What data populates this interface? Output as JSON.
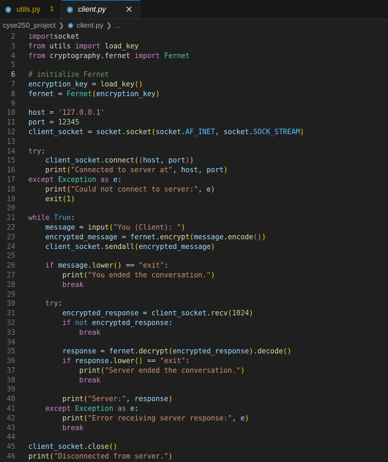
{
  "tabs": [
    {
      "label": "utils.py",
      "badge": "1"
    },
    {
      "label": "client.py",
      "close": "✕"
    }
  ],
  "breadcrumb": [
    "cyse250_project",
    "client.py",
    "..."
  ],
  "lines": [
    {
      "n": "2",
      "t": [
        [
          "kw",
          "import"
        ],
        [
          "",
          "socket"
        ]
      ]
    },
    {
      "n": "3",
      "t": [
        [
          "kw",
          "from"
        ],
        [
          "",
          " utils "
        ],
        [
          "kw",
          "import"
        ],
        [
          "",
          " "
        ],
        [
          "fn",
          "load_key"
        ]
      ]
    },
    {
      "n": "4",
      "t": [
        [
          "kw",
          "from"
        ],
        [
          "",
          " cryptography.fernet "
        ],
        [
          "kw",
          "import"
        ],
        [
          "",
          " "
        ],
        [
          "cls",
          "Fernet"
        ]
      ]
    },
    {
      "n": "5",
      "t": []
    },
    {
      "n": "6",
      "t": [
        [
          "cmt",
          "# initialize Fernet"
        ]
      ],
      "active": true
    },
    {
      "n": "7",
      "t": [
        [
          "var",
          "encryption_key"
        ],
        [
          "",
          " = "
        ],
        [
          "fn",
          "load_key"
        ],
        [
          "br1",
          "()"
        ]
      ]
    },
    {
      "n": "8",
      "t": [
        [
          "var",
          "fernet"
        ],
        [
          "",
          " = "
        ],
        [
          "cls",
          "Fernet"
        ],
        [
          "br1",
          "("
        ],
        [
          "var",
          "encryption_key"
        ],
        [
          "br1",
          ")"
        ]
      ]
    },
    {
      "n": "9",
      "t": []
    },
    {
      "n": "10",
      "t": [
        [
          "var",
          "host"
        ],
        [
          "",
          " = "
        ],
        [
          "str",
          "'127.0.0.1'"
        ]
      ]
    },
    {
      "n": "11",
      "t": [
        [
          "var",
          "port"
        ],
        [
          "",
          " = "
        ],
        [
          "num",
          "12345"
        ]
      ]
    },
    {
      "n": "12",
      "t": [
        [
          "var",
          "client_socket"
        ],
        [
          "",
          " = "
        ],
        [
          "var",
          "socket"
        ],
        [
          "",
          "."
        ],
        [
          "fn",
          "socket"
        ],
        [
          "br1",
          "("
        ],
        [
          "var",
          "socket"
        ],
        [
          "",
          "."
        ],
        [
          "const",
          "AF_INET"
        ],
        [
          "",
          ", "
        ],
        [
          "var",
          "socket"
        ],
        [
          "",
          "."
        ],
        [
          "const",
          "SOCK_STREAM"
        ],
        [
          "br1",
          ")"
        ]
      ]
    },
    {
      "n": "13",
      "t": []
    },
    {
      "n": "14",
      "t": [
        [
          "kw",
          "try"
        ],
        [
          "",
          ":"
        ]
      ]
    },
    {
      "n": "15",
      "t": [
        [
          "",
          "    "
        ],
        [
          "var",
          "client_socket"
        ],
        [
          "",
          "."
        ],
        [
          "fn",
          "connect"
        ],
        [
          "br1",
          "("
        ],
        [
          "br2",
          "("
        ],
        [
          "var",
          "host"
        ],
        [
          "",
          ", "
        ],
        [
          "var",
          "port"
        ],
        [
          "br2",
          ")"
        ],
        [
          "br1",
          ")"
        ]
      ]
    },
    {
      "n": "16",
      "t": [
        [
          "",
          "    "
        ],
        [
          "fn",
          "print"
        ],
        [
          "br1",
          "("
        ],
        [
          "str",
          "\"Connected to server at\""
        ],
        [
          "",
          ", "
        ],
        [
          "var",
          "host"
        ],
        [
          "",
          ", "
        ],
        [
          "var",
          "port"
        ],
        [
          "br1",
          ")"
        ]
      ]
    },
    {
      "n": "17",
      "t": [
        [
          "kw",
          "except"
        ],
        [
          "",
          " "
        ],
        [
          "cls",
          "Exception"
        ],
        [
          "",
          " "
        ],
        [
          "kw",
          "as"
        ],
        [
          "",
          " "
        ],
        [
          "var",
          "e"
        ],
        [
          "",
          ":"
        ]
      ]
    },
    {
      "n": "18",
      "t": [
        [
          "",
          "    "
        ],
        [
          "fn",
          "print"
        ],
        [
          "br1",
          "("
        ],
        [
          "str",
          "\"Could not connect to server:\""
        ],
        [
          "",
          ", "
        ],
        [
          "var",
          "e"
        ],
        [
          "br1",
          ")"
        ]
      ]
    },
    {
      "n": "19",
      "t": [
        [
          "",
          "    "
        ],
        [
          "fn",
          "exit"
        ],
        [
          "br1",
          "("
        ],
        [
          "num",
          "1"
        ],
        [
          "br1",
          ")"
        ]
      ]
    },
    {
      "n": "20",
      "t": []
    },
    {
      "n": "21",
      "t": [
        [
          "kw",
          "while"
        ],
        [
          "",
          " "
        ],
        [
          "kwb",
          "True"
        ],
        [
          "",
          ":"
        ]
      ]
    },
    {
      "n": "22",
      "t": [
        [
          "",
          "    "
        ],
        [
          "var",
          "message"
        ],
        [
          "",
          " = "
        ],
        [
          "fn",
          "input"
        ],
        [
          "br1",
          "("
        ],
        [
          "str",
          "\"You (Client): \""
        ],
        [
          "br1",
          ")"
        ]
      ]
    },
    {
      "n": "23",
      "t": [
        [
          "",
          "    "
        ],
        [
          "var",
          "encrypted_message"
        ],
        [
          "",
          " = "
        ],
        [
          "var",
          "fernet"
        ],
        [
          "",
          "."
        ],
        [
          "fn",
          "encrypt"
        ],
        [
          "br1",
          "("
        ],
        [
          "var",
          "message"
        ],
        [
          "",
          "."
        ],
        [
          "fn",
          "encode"
        ],
        [
          "br2",
          "()"
        ],
        [
          "br1",
          ")"
        ]
      ]
    },
    {
      "n": "24",
      "t": [
        [
          "",
          "    "
        ],
        [
          "var",
          "client_socket"
        ],
        [
          "",
          "."
        ],
        [
          "fn",
          "sendall"
        ],
        [
          "br1",
          "("
        ],
        [
          "var",
          "encrypted_message"
        ],
        [
          "br1",
          ")"
        ]
      ]
    },
    {
      "n": "25",
      "t": []
    },
    {
      "n": "26",
      "t": [
        [
          "",
          "    "
        ],
        [
          "kw",
          "if"
        ],
        [
          "",
          " "
        ],
        [
          "var",
          "message"
        ],
        [
          "",
          "."
        ],
        [
          "fn",
          "lower"
        ],
        [
          "br1",
          "()"
        ],
        [
          "",
          " == "
        ],
        [
          "str",
          "\"exit\""
        ],
        [
          "",
          ":"
        ]
      ]
    },
    {
      "n": "27",
      "t": [
        [
          "",
          "        "
        ],
        [
          "fn",
          "print"
        ],
        [
          "br1",
          "("
        ],
        [
          "str",
          "\"You ended the conversation.\""
        ],
        [
          "br1",
          ")"
        ]
      ]
    },
    {
      "n": "28",
      "t": [
        [
          "",
          "        "
        ],
        [
          "kw",
          "break"
        ]
      ]
    },
    {
      "n": "29",
      "t": []
    },
    {
      "n": "30",
      "t": [
        [
          "",
          "    "
        ],
        [
          "kw",
          "try"
        ],
        [
          "",
          ":"
        ]
      ]
    },
    {
      "n": "31",
      "t": [
        [
          "",
          "        "
        ],
        [
          "var",
          "encrypted_response"
        ],
        [
          "",
          " = "
        ],
        [
          "var",
          "client_socket"
        ],
        [
          "",
          "."
        ],
        [
          "fn",
          "recv"
        ],
        [
          "br1",
          "("
        ],
        [
          "num",
          "1024"
        ],
        [
          "br1",
          ")"
        ]
      ]
    },
    {
      "n": "32",
      "t": [
        [
          "",
          "        "
        ],
        [
          "kw",
          "if"
        ],
        [
          "",
          " "
        ],
        [
          "kwb",
          "not"
        ],
        [
          "",
          " "
        ],
        [
          "var",
          "encrypted_response"
        ],
        [
          "",
          ":"
        ]
      ]
    },
    {
      "n": "33",
      "t": [
        [
          "",
          "            "
        ],
        [
          "kw",
          "break"
        ]
      ]
    },
    {
      "n": "34",
      "t": []
    },
    {
      "n": "35",
      "t": [
        [
          "",
          "        "
        ],
        [
          "var",
          "response"
        ],
        [
          "",
          " = "
        ],
        [
          "var",
          "fernet"
        ],
        [
          "",
          "."
        ],
        [
          "fn",
          "decrypt"
        ],
        [
          "br1",
          "("
        ],
        [
          "var",
          "encrypted_response"
        ],
        [
          "br1",
          ")"
        ],
        [
          "",
          "."
        ],
        [
          "fn",
          "decode"
        ],
        [
          "br1",
          "()"
        ]
      ]
    },
    {
      "n": "36",
      "t": [
        [
          "",
          "        "
        ],
        [
          "kw",
          "if"
        ],
        [
          "",
          " "
        ],
        [
          "var",
          "response"
        ],
        [
          "",
          "."
        ],
        [
          "fn",
          "lower"
        ],
        [
          "br1",
          "()"
        ],
        [
          "",
          " == "
        ],
        [
          "str",
          "\"exit\""
        ],
        [
          "",
          ":"
        ]
      ]
    },
    {
      "n": "37",
      "t": [
        [
          "",
          "            "
        ],
        [
          "fn",
          "print"
        ],
        [
          "br1",
          "("
        ],
        [
          "str",
          "\"Server ended the conversation.\""
        ],
        [
          "br1",
          ")"
        ]
      ]
    },
    {
      "n": "38",
      "t": [
        [
          "",
          "            "
        ],
        [
          "kw",
          "break"
        ]
      ]
    },
    {
      "n": "39",
      "t": []
    },
    {
      "n": "40",
      "t": [
        [
          "",
          "        "
        ],
        [
          "fn",
          "print"
        ],
        [
          "br1",
          "("
        ],
        [
          "str",
          "\"Server:\""
        ],
        [
          "",
          ", "
        ],
        [
          "var",
          "response"
        ],
        [
          "br1",
          ")"
        ]
      ]
    },
    {
      "n": "41",
      "t": [
        [
          "",
          "    "
        ],
        [
          "kw",
          "except"
        ],
        [
          "",
          " "
        ],
        [
          "cls",
          "Exception"
        ],
        [
          "",
          " "
        ],
        [
          "kw",
          "as"
        ],
        [
          "",
          " "
        ],
        [
          "var",
          "e"
        ],
        [
          "",
          ":"
        ]
      ]
    },
    {
      "n": "42",
      "t": [
        [
          "",
          "        "
        ],
        [
          "fn",
          "print"
        ],
        [
          "br1",
          "("
        ],
        [
          "str",
          "\"Error receiving server response:\""
        ],
        [
          "",
          ", "
        ],
        [
          "var",
          "e"
        ],
        [
          "br1",
          ")"
        ]
      ]
    },
    {
      "n": "43",
      "t": [
        [
          "",
          "        "
        ],
        [
          "kw",
          "break"
        ]
      ]
    },
    {
      "n": "44",
      "t": []
    },
    {
      "n": "45",
      "t": [
        [
          "var",
          "client_socket"
        ],
        [
          "",
          "."
        ],
        [
          "fn",
          "close"
        ],
        [
          "br1",
          "()"
        ]
      ]
    },
    {
      "n": "46",
      "t": [
        [
          "fn",
          "print"
        ],
        [
          "br1",
          "("
        ],
        [
          "str",
          "\"Disconnected from server.\""
        ],
        [
          "br1",
          ")"
        ]
      ]
    }
  ]
}
